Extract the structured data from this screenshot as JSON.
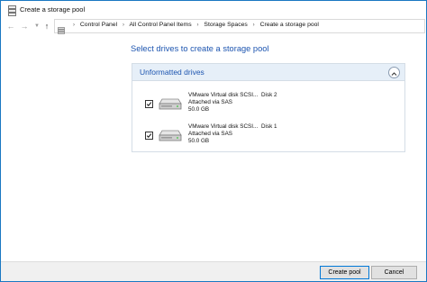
{
  "window": {
    "title": "Create a storage pool"
  },
  "nav": {
    "back_icon": "back-arrow-icon",
    "forward_icon": "forward-arrow-icon",
    "recent_icon": "chevron-down-icon",
    "up_icon": "up-arrow-icon",
    "breadcrumbs": [
      "Control Panel",
      "All Control Panel Items",
      "Storage Spaces",
      "Create a storage pool"
    ]
  },
  "main": {
    "heading": "Select drives to create a storage pool",
    "group": {
      "title": "Unformatted drives",
      "drives": [
        {
          "checked": true,
          "name": "VMware Virtual disk SCSI...",
          "disk": "Disk 2",
          "connection": "Attached via SAS",
          "size": "50.0 GB"
        },
        {
          "checked": true,
          "name": "VMware Virtual disk SCSI...",
          "disk": "Disk 1",
          "connection": "Attached via SAS",
          "size": "50.0 GB"
        }
      ]
    }
  },
  "footer": {
    "create_label": "Create pool",
    "cancel_label": "Cancel"
  },
  "colors": {
    "accent": "#1d55b0",
    "group_header_bg": "#e6eff8",
    "window_border": "#1a78c2"
  }
}
